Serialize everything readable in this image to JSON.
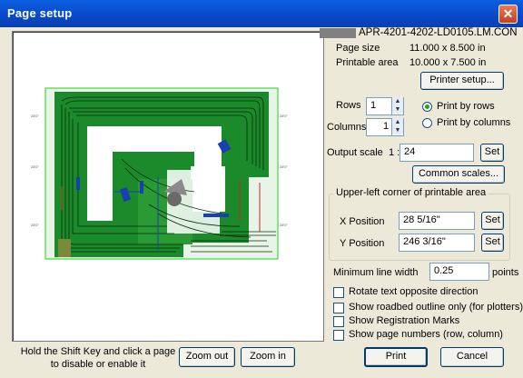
{
  "window": {
    "title": "Page setup",
    "close_glyph": "✕"
  },
  "file": {
    "name": "APR-4201-4202-LD0105.LM.CON"
  },
  "page_size": {
    "label": "Page size",
    "value": "11.000 x 8.500 in"
  },
  "printable_area": {
    "label": "Printable area",
    "value": "10.000 x 7.500 in"
  },
  "printer_setup": {
    "label": "Printer setup..."
  },
  "rows": {
    "label": "Rows",
    "value": "1"
  },
  "columns": {
    "label": "Columns",
    "value": "1"
  },
  "print_order": {
    "options": [
      {
        "label": "Print by rows",
        "selected": true
      },
      {
        "label": "Print by columns",
        "selected": false
      }
    ]
  },
  "output_scale": {
    "label": "Output scale",
    "prefix": "1 :",
    "value": "24",
    "set_label": "Set"
  },
  "common_scales": {
    "label": "Common scales..."
  },
  "corner": {
    "title": "Upper-left corner of printable area",
    "x": {
      "label": "X Position",
      "value": "28 5/16\"",
      "set_label": "Set"
    },
    "y": {
      "label": "Y Position",
      "value": "246 3/16\"",
      "set_label": "Set"
    }
  },
  "min_line_width": {
    "label": "Minimum line width",
    "value": "0.25",
    "unit": "points"
  },
  "options": [
    {
      "label": "Rotate text opposite direction",
      "checked": false
    },
    {
      "label": "Show roadbed outline only (for plotters)",
      "checked": false
    },
    {
      "label": "Show Registration Marks",
      "checked": false
    },
    {
      "label": "Show page numbers (row, column)",
      "checked": false
    }
  ],
  "hint": {
    "line1": "Hold the Shift Key and click a page",
    "line2": "to disable or enable it"
  },
  "zoom_out": {
    "label": "Zoom out"
  },
  "zoom_in": {
    "label": "Zoom in"
  },
  "print": {
    "label": "Print"
  },
  "cancel": {
    "label": "Cancel"
  },
  "colors": {
    "titlebar": "#0a5fe0",
    "layout_green": "#1a8a2a",
    "page_border": "#3cdc3c"
  }
}
